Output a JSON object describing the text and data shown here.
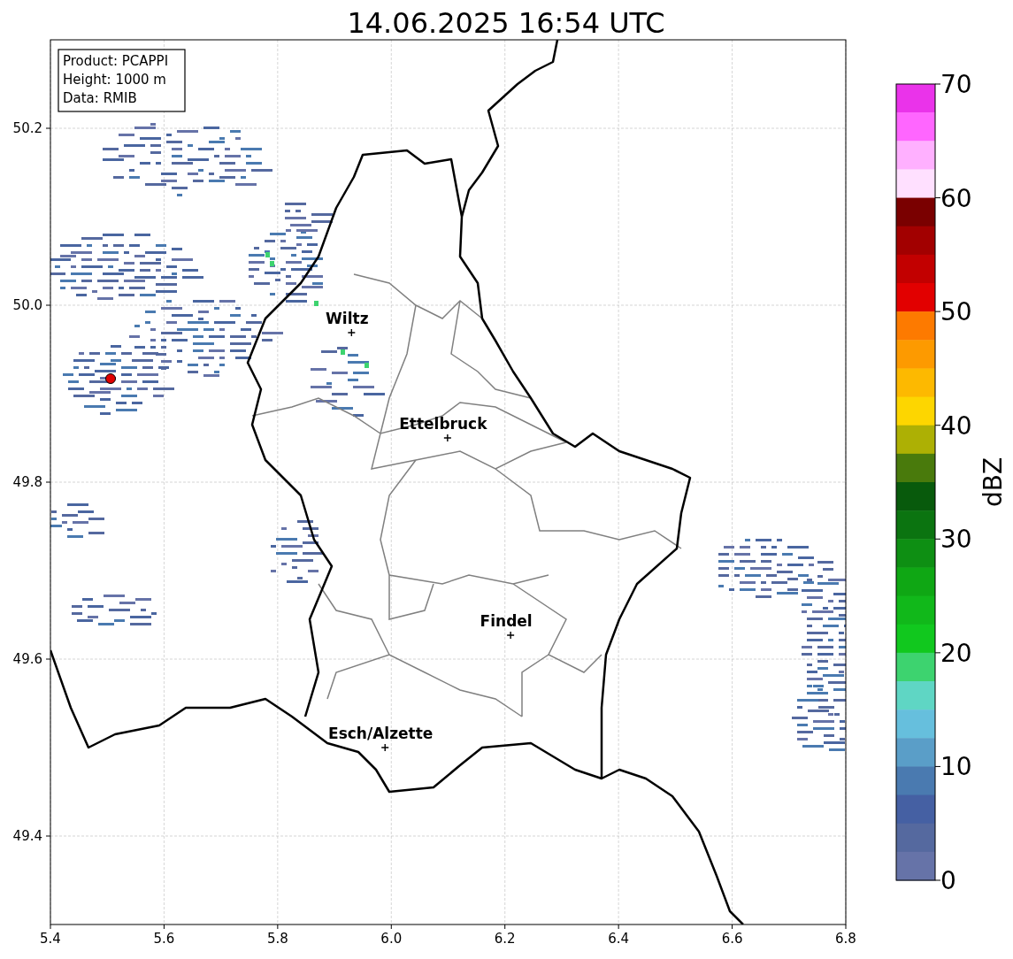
{
  "title": "14.06.2025 16:54 UTC",
  "info_box": [
    "Product: PCAPPI",
    "Height: 1000 m",
    "Data: RMIB"
  ],
  "x_ticks": [
    "5.4",
    "5.6",
    "5.8",
    "6.0",
    "6.2",
    "6.4",
    "6.6",
    "6.8"
  ],
  "y_ticks": [
    "50.2",
    "50.0",
    "49.8",
    "49.6",
    "49.4"
  ],
  "cities": [
    {
      "name": "Wiltz"
    },
    {
      "name": "Ettelbruck"
    },
    {
      "name": "Findel"
    },
    {
      "name": "Esch/Alzette"
    }
  ],
  "colorbar": {
    "label": "dBZ",
    "ticks": [
      "70",
      "60",
      "50",
      "40",
      "30",
      "20",
      "10",
      "0"
    ],
    "bins": [
      {
        "color": "#ea33ea"
      },
      {
        "color": "#ff66ff"
      },
      {
        "color": "#ffb0ff"
      },
      {
        "color": "#ffe0ff"
      },
      {
        "color": "#7a0000"
      },
      {
        "color": "#a20000"
      },
      {
        "color": "#c20000"
      },
      {
        "color": "#e20000"
      },
      {
        "color": "#fd7a00"
      },
      {
        "color": "#fd9a00"
      },
      {
        "color": "#fdb900"
      },
      {
        "color": "#fdd600"
      },
      {
        "color": "#adb004"
      },
      {
        "color": "#497a0c"
      },
      {
        "color": "#085a0c"
      },
      {
        "color": "#0b7410"
      },
      {
        "color": "#0e8f13"
      },
      {
        "color": "#0fa714"
      },
      {
        "color": "#11b81a"
      },
      {
        "color": "#11c81e"
      },
      {
        "color": "#3dd36f"
      },
      {
        "color": "#5fd6c4"
      },
      {
        "color": "#66bfdd"
      },
      {
        "color": "#5a9ec8"
      },
      {
        "color": "#4a7ab0"
      },
      {
        "color": "#4560a3"
      },
      {
        "color": "#55699f"
      },
      {
        "color": "#6673a8"
      }
    ]
  }
}
